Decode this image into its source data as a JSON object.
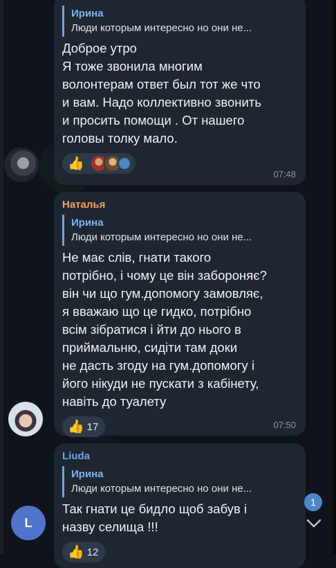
{
  "messages": [
    {
      "sender": "",
      "quote_name": "Ирина",
      "quote_text": "Люди которым интересно но они не...",
      "text_lines": [
        "Доброе утро",
        "Я тоже звонила многим",
        "волонтерам ответ был тот же что",
        "и вам. Надо коллективно звонить",
        "и просить помощи . От нашего",
        "головы толку мало."
      ],
      "reaction_emoji": "👍",
      "reaction_count": "",
      "time": "07:48"
    },
    {
      "sender": "Наталья",
      "quote_name": "Ирина",
      "quote_text": "Люди которым интересно но они не...",
      "text_lines": [
        "Не має слів, гнати такого",
        "потрібно, і чому це він забороняє?",
        "він чи що гум.допомогу замовляє,",
        "я вважаю що це гидко, потрібно",
        "всім зібратися і йти до нього в",
        "приймальню, сидіти там доки",
        "не дасть згоду на гум.допомогу і",
        "його нікуди не пускати з кабінету,",
        "навіть до туалету"
      ],
      "reaction_emoji": "👍",
      "reaction_count": "17",
      "time": "07:50"
    },
    {
      "sender": "Liuda",
      "quote_name": "Ирина",
      "quote_text": "Люди которым интересно но они не...",
      "text_lines": [
        "Так гнати це бидло щоб забув і",
        "назву селища !!!"
      ],
      "reaction_emoji": "👍",
      "reaction_count": "12",
      "time": ""
    }
  ],
  "avatar_letter": "L",
  "unread_badge": "1",
  "colors": {
    "sender_natalia": "#f0a35a",
    "sender_liuda": "#6ea6e6",
    "quote_bar": "#6ea6e6",
    "bubble": "#1e2630",
    "avatar_liuda": "#4f74c9"
  }
}
